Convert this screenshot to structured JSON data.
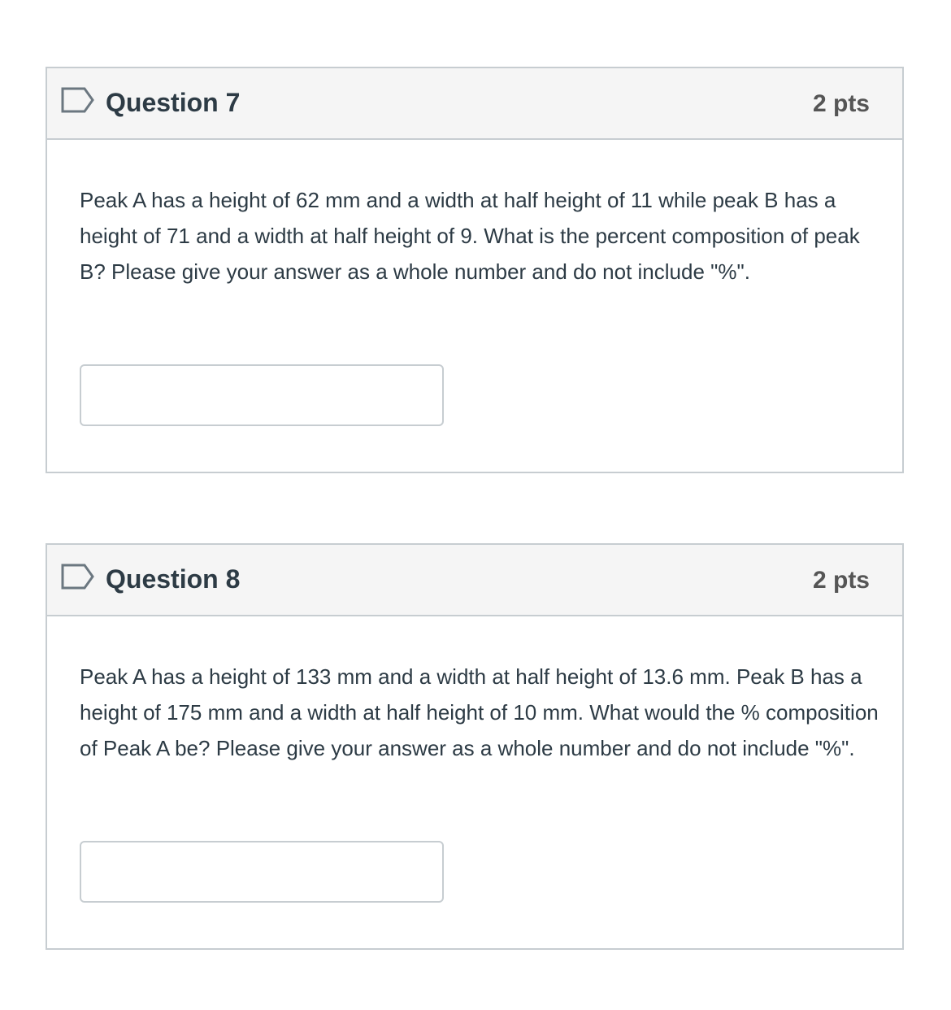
{
  "questions": [
    {
      "title": "Question 7",
      "points": "2 pts",
      "text": "Peak A has a height of 62 mm and a width at half height of 11 while peak B has a height of 71 and a width at half height of 9. What is the percent composition of peak B? Please give your answer as a whole number and do not include \"%\".",
      "answer_value": "",
      "flag_icon": "flag-outline-icon"
    },
    {
      "title": "Question 8",
      "points": "2 pts",
      "text": "Peak A has a height of 133 mm and a width at half height of 13.6 mm.  Peak B has a height of 175 mm and a width at half height of 10 mm.  What would the % composition of Peak A be?  Please give your answer as a whole number and do not include \"%\".",
      "answer_value": "",
      "flag_icon": "flag-outline-icon"
    }
  ],
  "colors": {
    "header_bg": "#f5f5f5",
    "border": "#c7cdd1",
    "text": "#2d3b45",
    "points": "#555555",
    "flag": "#6b7780"
  }
}
